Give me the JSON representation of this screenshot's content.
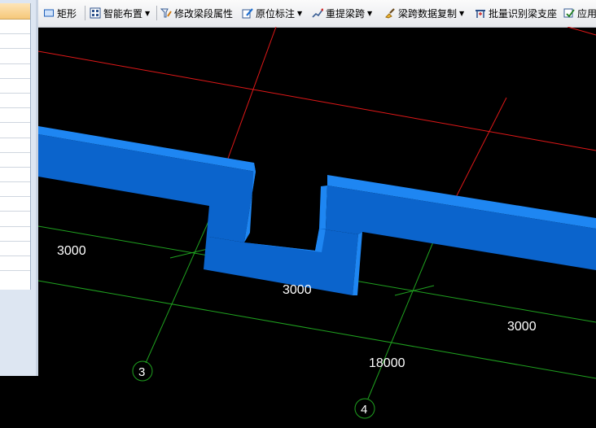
{
  "toolbar": {
    "rect_label": "矩形",
    "smart_layout_label": "智能布置",
    "modify_beam_segment_label": "修改梁段属性",
    "origin_annotation_label": "原位标注",
    "re_extract_span_label": "重提梁跨",
    "span_data_copy_label": "梁跨数据复制",
    "batch_identify_support_label": "批量识别梁支座",
    "apply_label": "应用"
  },
  "drawing": {
    "dim_left": "3000",
    "dim_center": "3000",
    "dim_right": "3000",
    "dim_total": "18000",
    "axis_3": "3",
    "axis_4": "4"
  },
  "colors": {
    "background": "#000000",
    "beam_top": "#1e86f2",
    "beam_side": "#0b64cc",
    "red_grid": "#e01818",
    "green_grid": "#1fa11f"
  }
}
